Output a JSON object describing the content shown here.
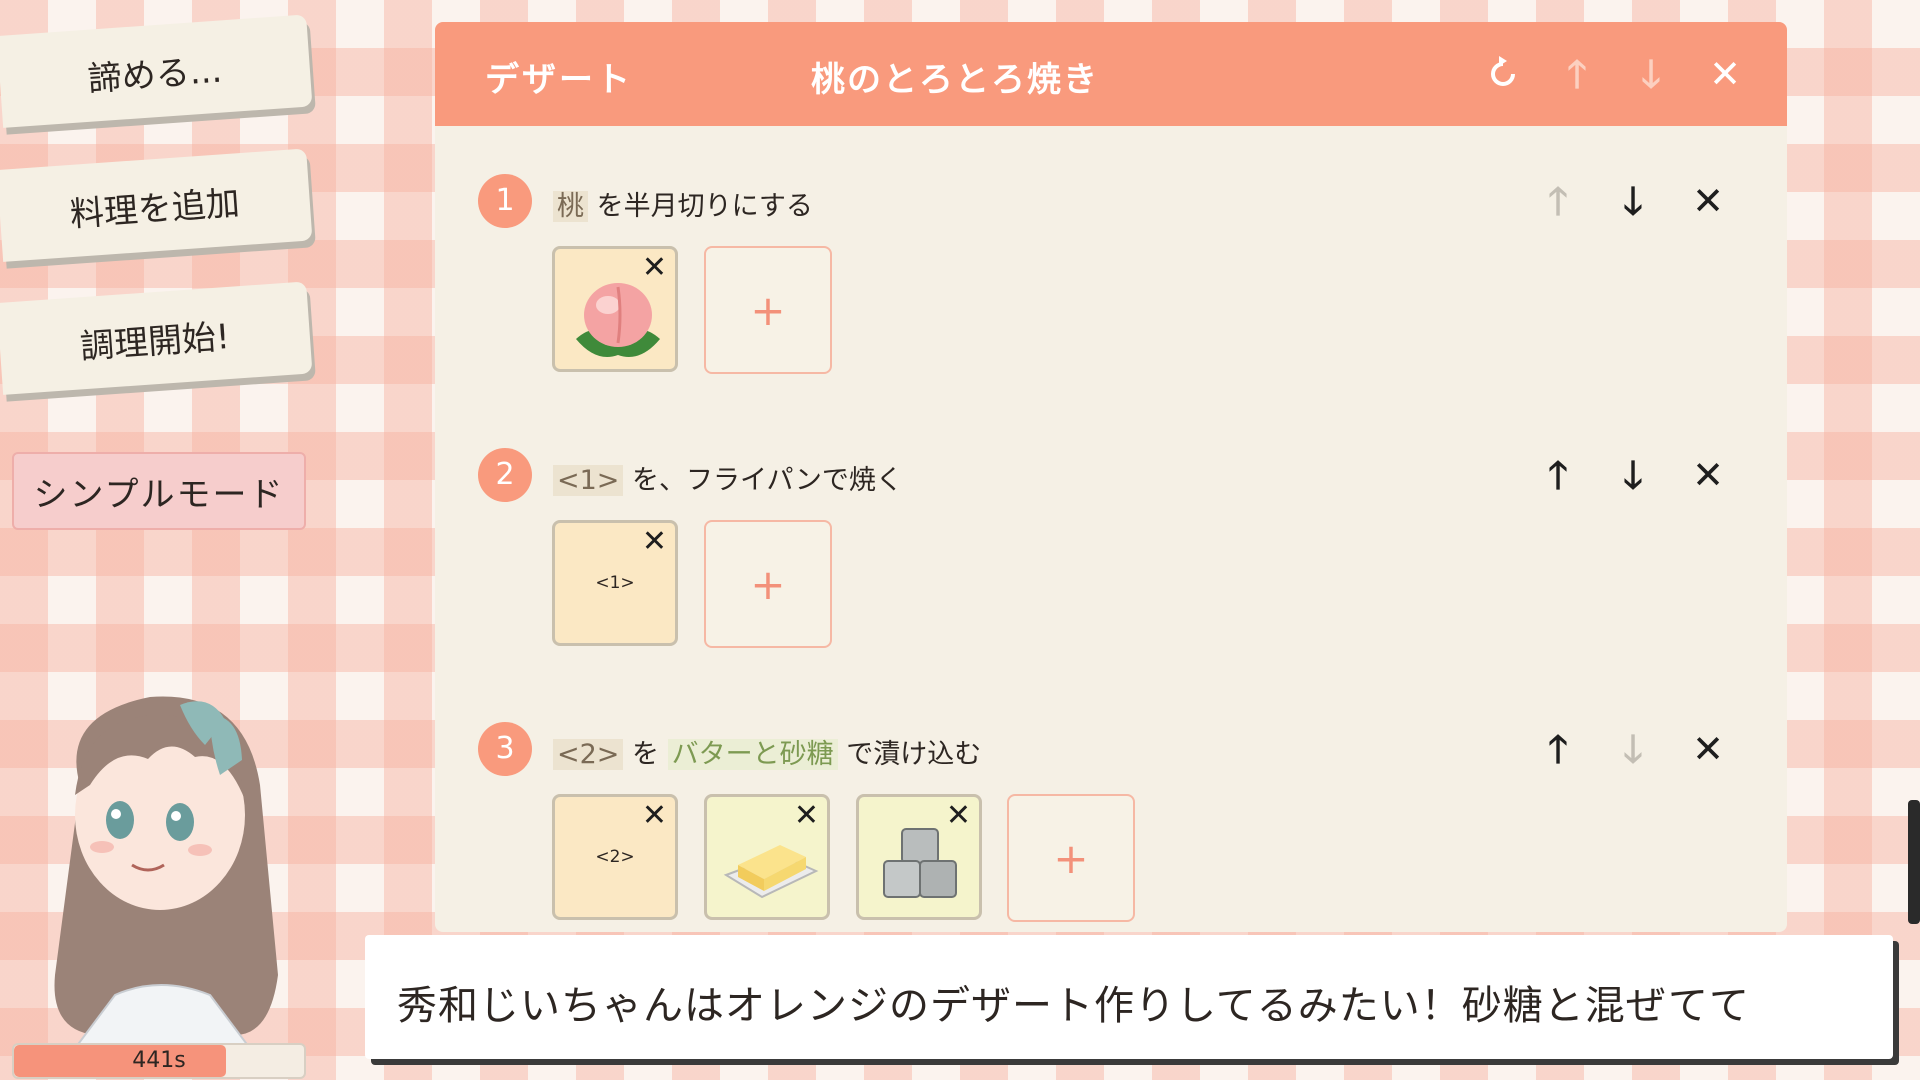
{
  "side_menu": {
    "give_up": "諦める...",
    "add_dish": "料理を追加",
    "start_cooking": "調理開始!",
    "simple_mode": "シンプルモード"
  },
  "timer": {
    "text": "441s",
    "fill_fraction": 0.73
  },
  "recipe": {
    "category": "デザート",
    "dish_name": "桃のとろとろ焼き",
    "header_icons": [
      "reset-icon",
      "arrow-up-icon",
      "arrow-down-icon",
      "close-icon"
    ],
    "steps": [
      {
        "number": "1",
        "tag1": "桃",
        "text1": " を半月切りにする",
        "ingredients": [
          {
            "type": "peach-icon",
            "label": ""
          }
        ],
        "add": "+"
      },
      {
        "number": "2",
        "tag1": "<1>",
        "text1": " を、フライパンで焼く",
        "ingredients": [
          {
            "type": "reference",
            "label": "<1>"
          }
        ],
        "add": "+"
      },
      {
        "number": "3",
        "tag1": "<2>",
        "text1": " を ",
        "tag2": "バターと砂糖",
        "text2": " で漬け込む",
        "ingredients": [
          {
            "type": "reference",
            "label": "<2>"
          },
          {
            "type": "butter-icon",
            "label": ""
          },
          {
            "type": "sugar-cubes-icon",
            "label": ""
          }
        ],
        "add": "+"
      }
    ],
    "glyphs": {
      "up": "🡑",
      "down": "🡓",
      "close": "✕",
      "remove": "✕"
    }
  },
  "dialog": {
    "text": "秀和じいちゃんはオレンジのデザート作りしてるみたい！砂糖と混ぜてて"
  },
  "colors": {
    "accent": "#f99a7d",
    "panel": "#f5f0e5",
    "slot": "#fbe8c4"
  }
}
